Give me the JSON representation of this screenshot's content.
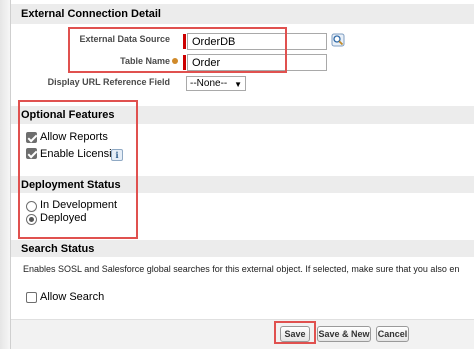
{
  "sections": {
    "connection_detail": "External Connection Detail",
    "optional_features": "Optional Features",
    "deployment_status": "Deployment Status",
    "search_status": "Search Status"
  },
  "fields": {
    "external_data_source": {
      "label": "External Data Source",
      "value": "OrderDB"
    },
    "table_name": {
      "label": "Table Name",
      "value": "Order"
    },
    "display_url": {
      "label": "Display URL Reference Field",
      "selected": "--None--"
    }
  },
  "optional_features": {
    "allow_reports": {
      "label": "Allow Reports",
      "checked": true
    },
    "enable_licensing": {
      "label": "Enable Licensing",
      "checked": true
    }
  },
  "deployment": {
    "in_development": {
      "label": "In Development",
      "selected": false
    },
    "deployed": {
      "label": "Deployed",
      "selected": true
    }
  },
  "search": {
    "description": "Enables SOSL and Salesforce global searches for this external object. If selected, make sure that you also en",
    "allow_search": {
      "label": "Allow Search",
      "checked": false
    }
  },
  "buttons": {
    "save": "Save",
    "save_new": "Save & New",
    "cancel": "Cancel"
  },
  "colors": {
    "highlight": "#e0514f",
    "required": "#cc0000",
    "section_bg": "#ececec"
  }
}
